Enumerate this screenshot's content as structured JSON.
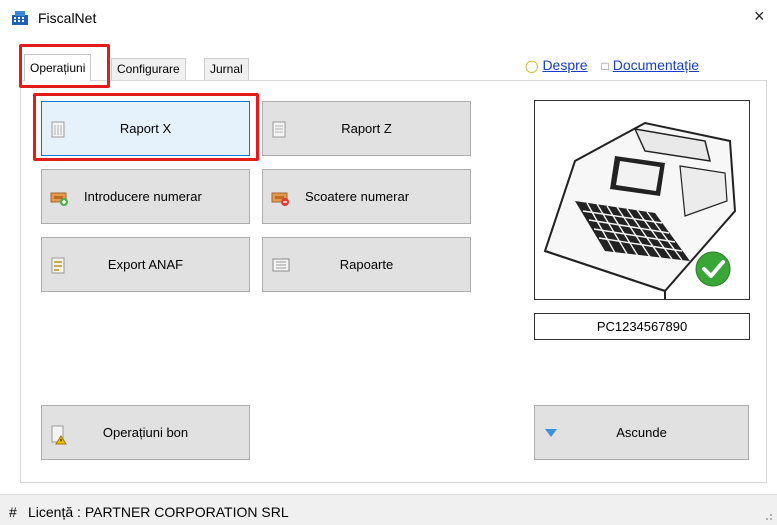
{
  "window": {
    "title": "FiscalNet",
    "close_icon": "×"
  },
  "tabs": [
    {
      "label": "Operațiuni",
      "active": true
    },
    {
      "label": "Configurare",
      "active": false
    },
    {
      "label": "Jurnal",
      "active": false
    }
  ],
  "links": {
    "about": "Despre",
    "docs": "Documentație"
  },
  "buttons": {
    "raport_x": "Raport X",
    "raport_z": "Raport Z",
    "introducere": "Introducere numerar",
    "scoatere": "Scoatere numerar",
    "export_anaf": "Export ANAF",
    "rapoarte": "Rapoarte",
    "operatiuni_bon": "Operațiuni bon",
    "ascunde": "Ascunde"
  },
  "device": {
    "serial": "PC1234567890",
    "status_icon": "check-circle-icon"
  },
  "status": {
    "prefix": "#",
    "text": "Licență : PARTNER CORPORATION SRL"
  },
  "colors": {
    "highlight": "#e41b1b",
    "link": "#1a3fbf",
    "focus": "#0078d7",
    "ok": "#3aa637"
  }
}
